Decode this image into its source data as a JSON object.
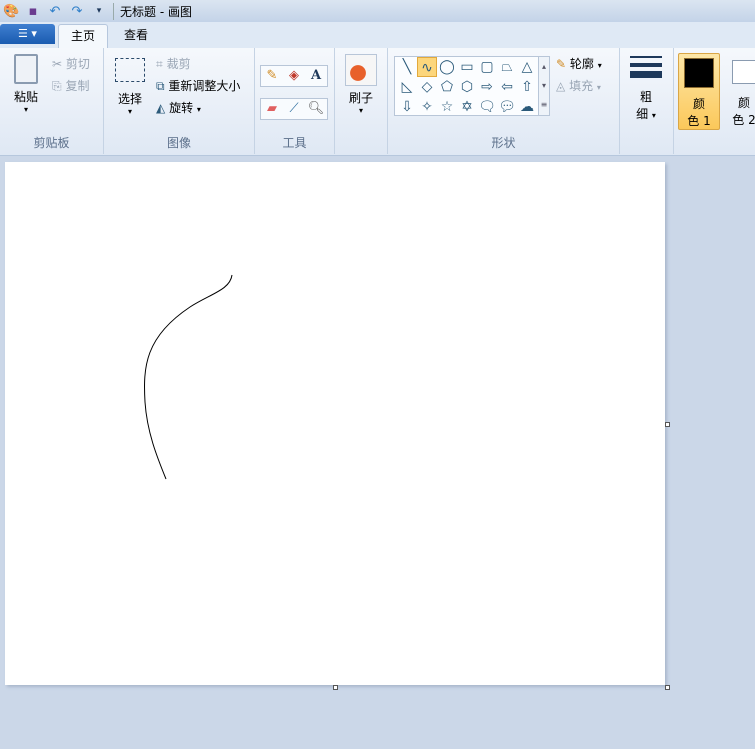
{
  "window": {
    "title": "无标题 - 画图"
  },
  "quick_access": {
    "icons": [
      "paint-app-icon",
      "save-icon",
      "undo-icon",
      "redo-icon",
      "customize-dropdown-icon"
    ]
  },
  "tabs": [
    {
      "label": "主页",
      "active": true
    },
    {
      "label": "查看",
      "active": false
    }
  ],
  "clipboard": {
    "paste": "粘贴",
    "cut": "剪切",
    "copy": "复制",
    "group": "剪贴板"
  },
  "image": {
    "select": "选择",
    "crop": "裁剪",
    "resize": "重新调整大小",
    "rotate": "旋转",
    "group": "图像"
  },
  "tools": {
    "group": "工具"
  },
  "brushes": {
    "label": "刷子"
  },
  "shapes": {
    "group": "形状",
    "outline": "轮廓",
    "fill": "填充",
    "selected": "curve"
  },
  "size": {
    "line1": "粗",
    "line2": "细"
  },
  "colors": {
    "color1_line1": "颜",
    "color1_line2": "色 1",
    "color2_line1": "颜",
    "color2_line2": "色 2",
    "color1": "#000000",
    "color2": "#ffffff"
  }
}
